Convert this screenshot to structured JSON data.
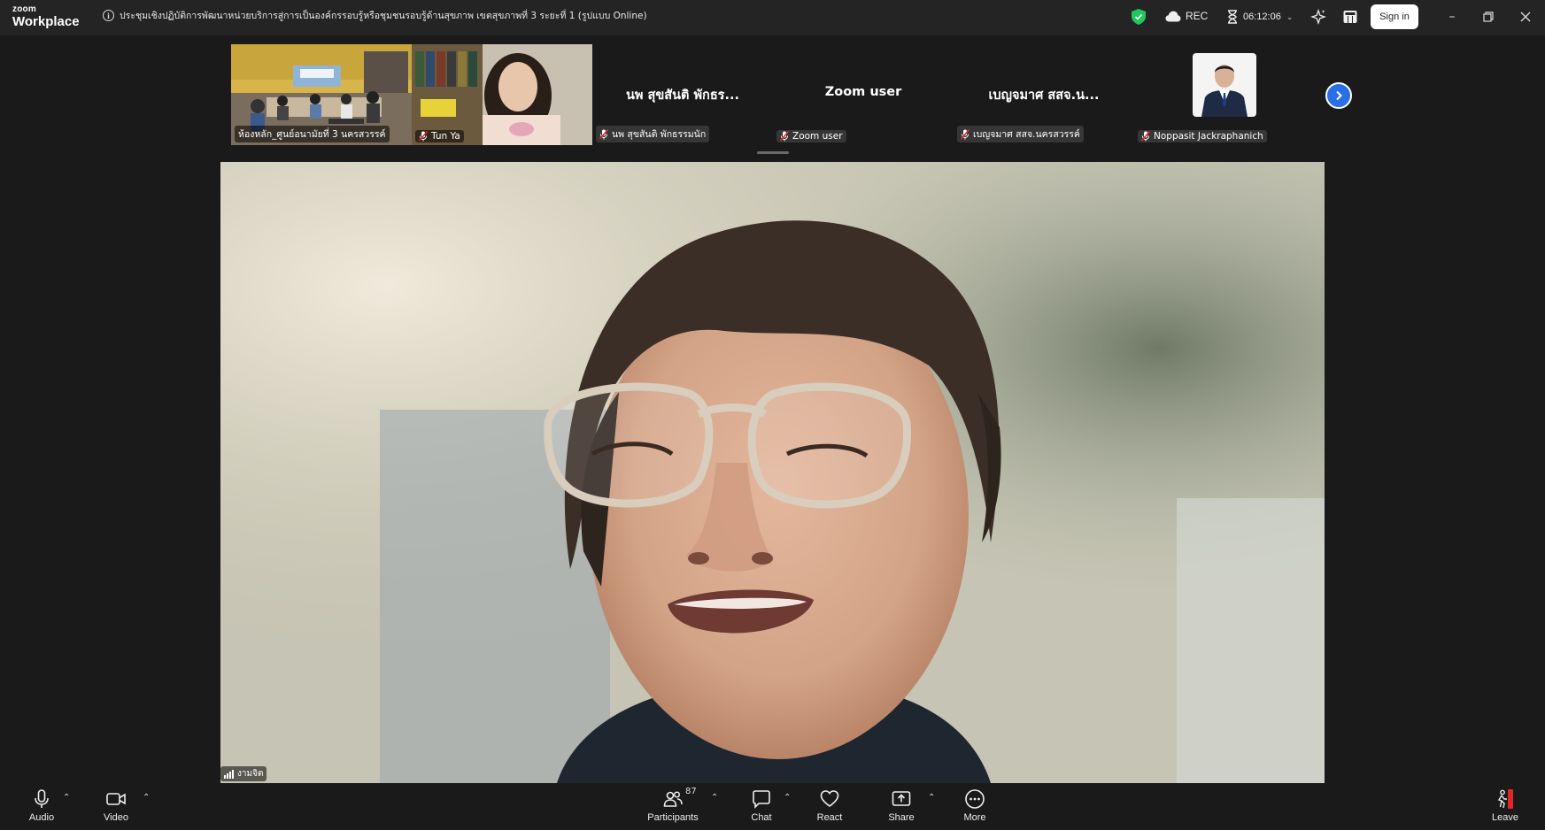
{
  "app": {
    "logo_top": "zoom",
    "logo_bottom": "Workplace"
  },
  "meeting": {
    "title": "ประชุมเชิงปฏิบัติการพัฒนาหน่วยบริการสู่การเป็นองค์กรรอบรู้หรือชุมชนรอบรู้ด้านสุขภาพ เขตสุขภาพที่ 3 ระยะที่ 1 (รูปแบบ Online)",
    "rec_label": "REC",
    "elapsed": "06:12:06",
    "sign_in": "Sign in"
  },
  "participants_strip": [
    {
      "display_name": "",
      "label": "ห้องหลัก_ศูนย์อนามัยที่ 3 นครสวรรค์",
      "kind": "video-room",
      "muted": false
    },
    {
      "display_name": "",
      "label": "Tun Ya",
      "kind": "video-person",
      "muted": true
    },
    {
      "display_name": "นพ สุขสันติ พักธร...",
      "label": "นพ สุขสันติ พักธรรมนัก",
      "kind": "name",
      "muted": true
    },
    {
      "display_name": "Zoom user",
      "label": "Zoom user",
      "kind": "name",
      "muted": true
    },
    {
      "display_name": "เบญจมาศ สสจ.น...",
      "label": "เบญจมาศ สสจ.นครสวรรค์",
      "kind": "name",
      "muted": true
    },
    {
      "display_name": "",
      "label": "Noppasit Jackraphanich",
      "kind": "avatar",
      "muted": true
    }
  ],
  "main_video": {
    "speaker_label": "งามจิต"
  },
  "toolbar": {
    "audio": "Audio",
    "video": "Video",
    "participants": "Participants",
    "participant_count": "87",
    "chat": "Chat",
    "react": "React",
    "share": "Share",
    "more": "More",
    "leave": "Leave"
  },
  "colors": {
    "accent_blue": "#2a6ee8",
    "muted_red": "#e02828",
    "shield_green": "#22c55e",
    "leave_red": "#e02828"
  }
}
